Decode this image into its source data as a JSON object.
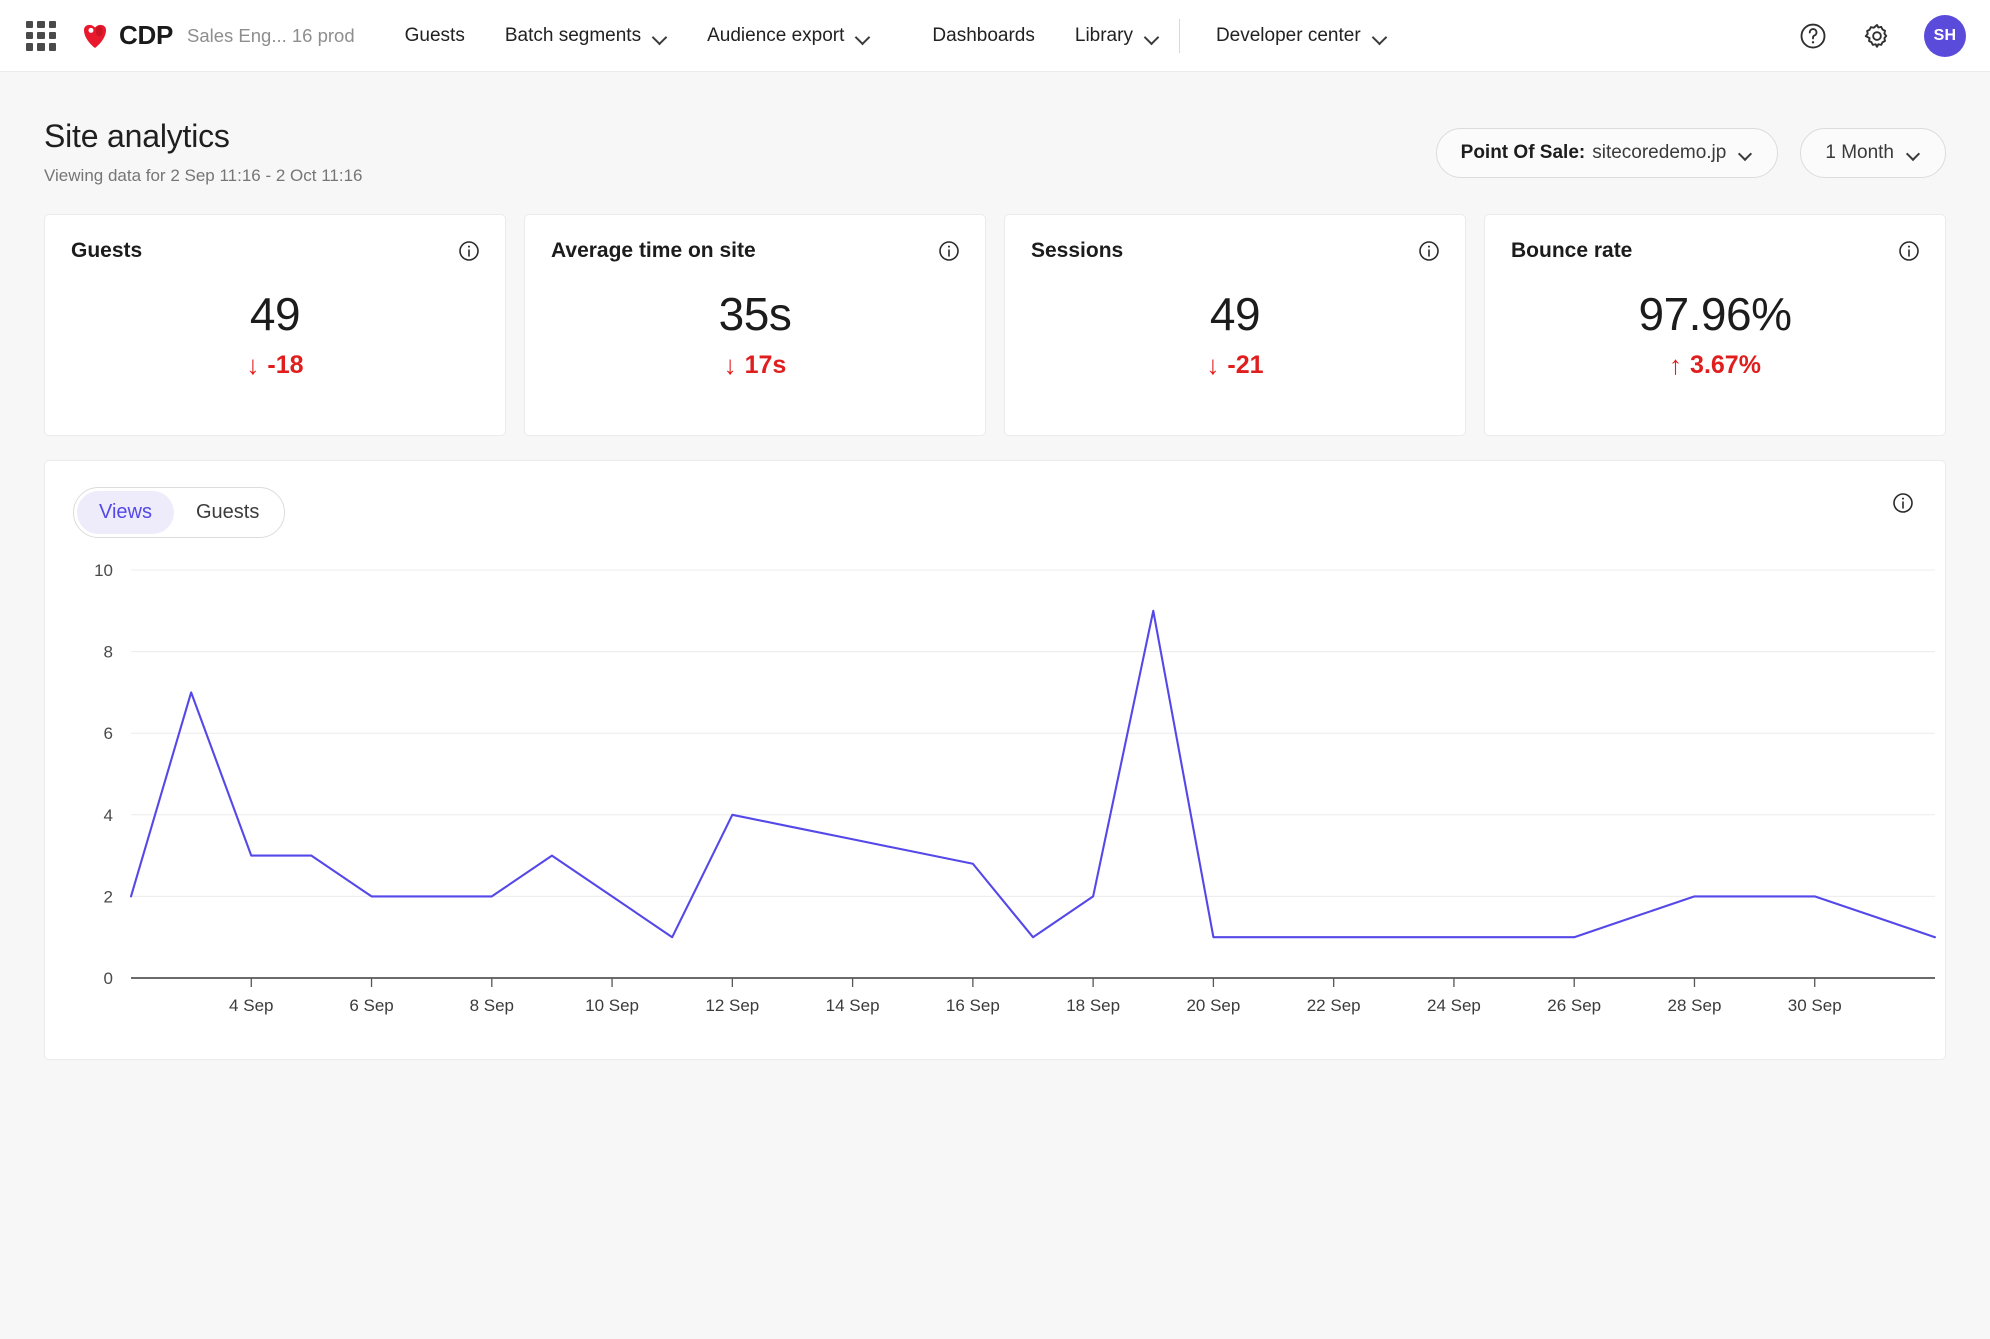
{
  "topnav": {
    "waffle_icon": "apps-grid-icon",
    "brand": {
      "logo_icon": "sitecore-logo-icon",
      "label": "CDP"
    },
    "tenant": "Sales Eng... 16 prod",
    "items": [
      {
        "label": "Guests",
        "caret": false
      },
      {
        "label": "Batch segments",
        "caret": true
      },
      {
        "label": "Audience export",
        "caret": true
      },
      {
        "label": "Dashboards",
        "caret": false
      },
      {
        "label": "Library",
        "caret": true
      }
    ],
    "right_group": [
      {
        "label": "Developer center",
        "caret": true
      }
    ],
    "help_icon": "help-circle-icon",
    "settings_icon": "gear-icon",
    "avatar_initials": "SH",
    "avatar_color": "#5a4bdb"
  },
  "header": {
    "title": "Site analytics",
    "subtitle": "Viewing data for 2 Sep 11:16 - 2 Oct 11:16",
    "point_of_sale": {
      "label": "Point Of Sale:",
      "value": "sitecoredemo.jp"
    },
    "time_range": "1 Month"
  },
  "kpis": [
    {
      "title": "Guests",
      "value": "49",
      "delta": "-18",
      "direction": "down",
      "arrow": "↓",
      "color": "#e01e1e",
      "info_icon": "info-circle-icon"
    },
    {
      "title": "Average time on site",
      "value": "35s",
      "delta": "17s",
      "direction": "down",
      "arrow": "↓",
      "color": "#e01e1e",
      "info_icon": "info-circle-icon"
    },
    {
      "title": "Sessions",
      "value": "49",
      "delta": "-21",
      "direction": "down",
      "arrow": "↓",
      "color": "#e01e1e",
      "info_icon": "info-circle-icon"
    },
    {
      "title": "Bounce rate",
      "value": "97.96%",
      "delta": "3.67%",
      "direction": "up",
      "arrow": "↑",
      "color": "#e01e1e",
      "info_icon": "info-circle-icon"
    }
  ],
  "chart_panel": {
    "tabs": [
      {
        "label": "Views",
        "active": true
      },
      {
        "label": "Guests",
        "active": false
      }
    ],
    "info_icon": "info-circle-icon"
  },
  "chart_data": {
    "type": "line",
    "title": "",
    "xlabel": "",
    "ylabel": "",
    "ylim": [
      0,
      10
    ],
    "yticks": [
      0,
      2,
      4,
      6,
      8,
      10
    ],
    "grid": true,
    "legend_position": "none",
    "line_color": "#5548e8",
    "xtick_labels": [
      "4 Sep",
      "6 Sep",
      "8 Sep",
      "10 Sep",
      "12 Sep",
      "14 Sep",
      "16 Sep",
      "18 Sep",
      "20 Sep",
      "22 Sep",
      "24 Sep",
      "26 Sep",
      "28 Sep",
      "30 Sep"
    ],
    "x": [
      "2 Sep",
      "3 Sep",
      "4 Sep",
      "5 Sep",
      "6 Sep",
      "7 Sep",
      "8 Sep",
      "9 Sep",
      "10 Sep",
      "11 Sep",
      "12 Sep",
      "13 Sep",
      "14 Sep",
      "15 Sep",
      "16 Sep",
      "17 Sep",
      "18 Sep",
      "19 Sep",
      "20 Sep",
      "21 Sep",
      "22 Sep",
      "23 Sep",
      "24 Sep",
      "25 Sep",
      "26 Sep",
      "27 Sep",
      "28 Sep",
      "29 Sep",
      "30 Sep",
      "1 Oct",
      "2 Oct"
    ],
    "series": [
      {
        "name": "Views",
        "values": [
          2,
          7,
          3,
          3,
          2,
          2,
          2,
          3,
          2,
          1,
          4,
          3.7,
          3.4,
          3.1,
          2.8,
          1,
          2,
          9,
          1,
          1,
          1,
          1,
          1,
          1,
          1,
          1.5,
          2,
          2,
          2,
          1.5,
          1
        ]
      }
    ]
  }
}
